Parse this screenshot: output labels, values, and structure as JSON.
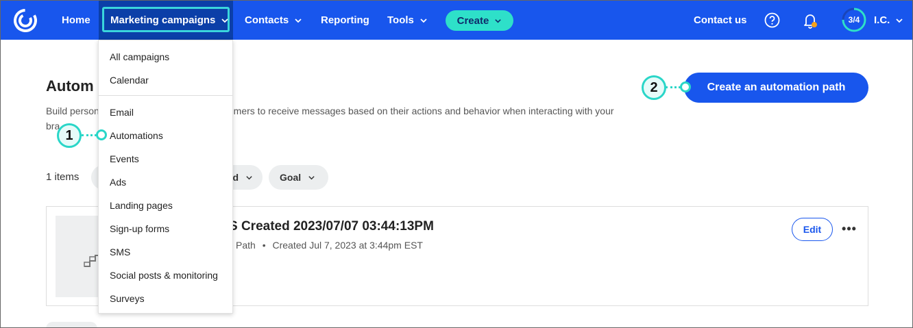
{
  "nav": {
    "logo": "constant-contact-logo",
    "items": [
      {
        "label": "Home",
        "has_chevron": false
      },
      {
        "label": "Marketing campaigns",
        "has_chevron": true,
        "active": true
      },
      {
        "label": "Contacts",
        "has_chevron": true
      },
      {
        "label": "Reporting",
        "has_chevron": false
      },
      {
        "label": "Tools",
        "has_chevron": true
      }
    ],
    "create_label": "Create",
    "contact_us": "Contact us",
    "progress": "3/4",
    "user_initials": "I.C.",
    "colors": {
      "bar": "#1856ed",
      "accent": "#2ee0c9",
      "highlight": "#3ad6dc"
    }
  },
  "dropdown": {
    "items": [
      "All campaigns",
      "Calendar",
      "Email",
      "Automations",
      "Events",
      "Ads",
      "Landing pages",
      "Sign-up forms",
      "SMS",
      "Social posts & monitoring",
      "Surveys"
    ]
  },
  "page": {
    "title_visible": "Autom",
    "desc_line1_left": "Build person",
    "desc_line1_right": "stomers to receive messages based on their actions and behavior when interacting with your",
    "desc_line2": "bra",
    "create_path_label": "Create an automation path",
    "items_count": "1 items",
    "filter_partial": "d",
    "filter_goal": "Goal"
  },
  "card": {
    "title_visible": "S Created 2023/07/07 03:44:13PM",
    "meta_type": "Path",
    "meta_created": "Created Jul 7, 2023 at 3:44pm EST",
    "edit_label": "Edit",
    "more_label": "•••"
  },
  "callouts": [
    {
      "number": "1"
    },
    {
      "number": "2"
    }
  ]
}
